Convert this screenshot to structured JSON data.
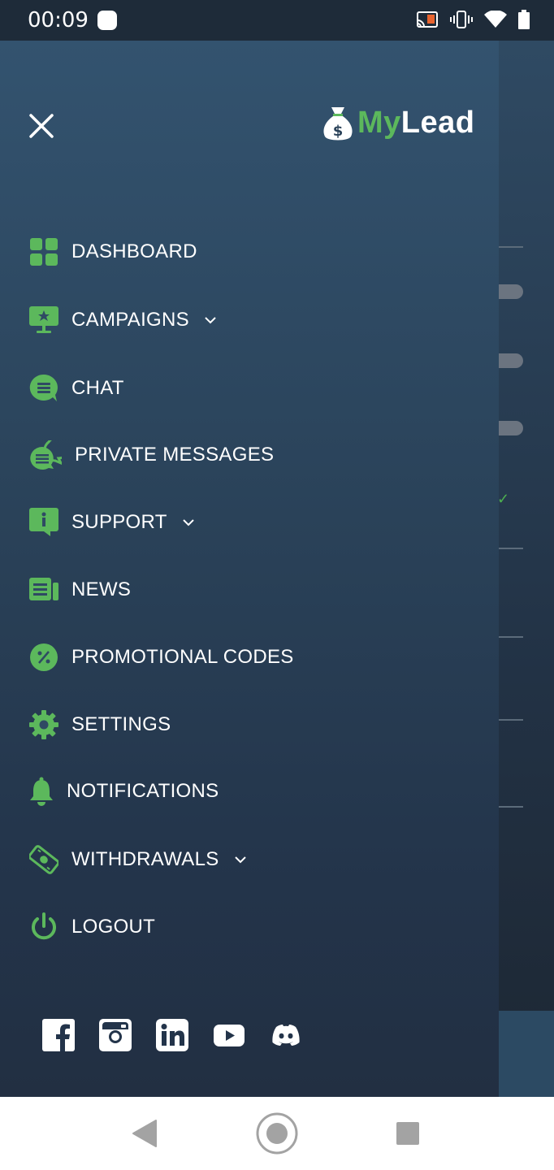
{
  "status_bar": {
    "time": "00:09"
  },
  "brand": {
    "my": "My",
    "lead": "Lead"
  },
  "menu": [
    {
      "label": "DASHBOARD",
      "icon": "dashboard-grid-icon"
    },
    {
      "label": "CAMPAIGNS",
      "icon": "campaigns-monitor-icon",
      "expandable": true
    },
    {
      "label": "CHAT",
      "icon": "chat-bubble-icon"
    },
    {
      "label": "PRIVATE MESSAGES",
      "icon": "private-messages-icon"
    },
    {
      "label": "SUPPORT",
      "icon": "support-info-icon",
      "expandable": true
    },
    {
      "label": "NEWS",
      "icon": "news-icon"
    },
    {
      "label": "PROMOTIONAL CODES",
      "icon": "promo-percent-icon"
    },
    {
      "label": "SETTINGS",
      "icon": "gear-icon"
    },
    {
      "label": "NOTIFICATIONS",
      "icon": "bell-icon"
    },
    {
      "label": "WITHDRAWALS",
      "icon": "withdrawals-money-icon",
      "expandable": true
    },
    {
      "label": "LOGOUT",
      "icon": "power-icon"
    }
  ],
  "social": [
    "facebook-icon",
    "instagram-icon",
    "linkedin-icon",
    "youtube-icon",
    "discord-icon"
  ],
  "colors": {
    "accent": "#5cb85c",
    "drawer_top": "#33536f",
    "drawer_bottom": "#222f42"
  }
}
